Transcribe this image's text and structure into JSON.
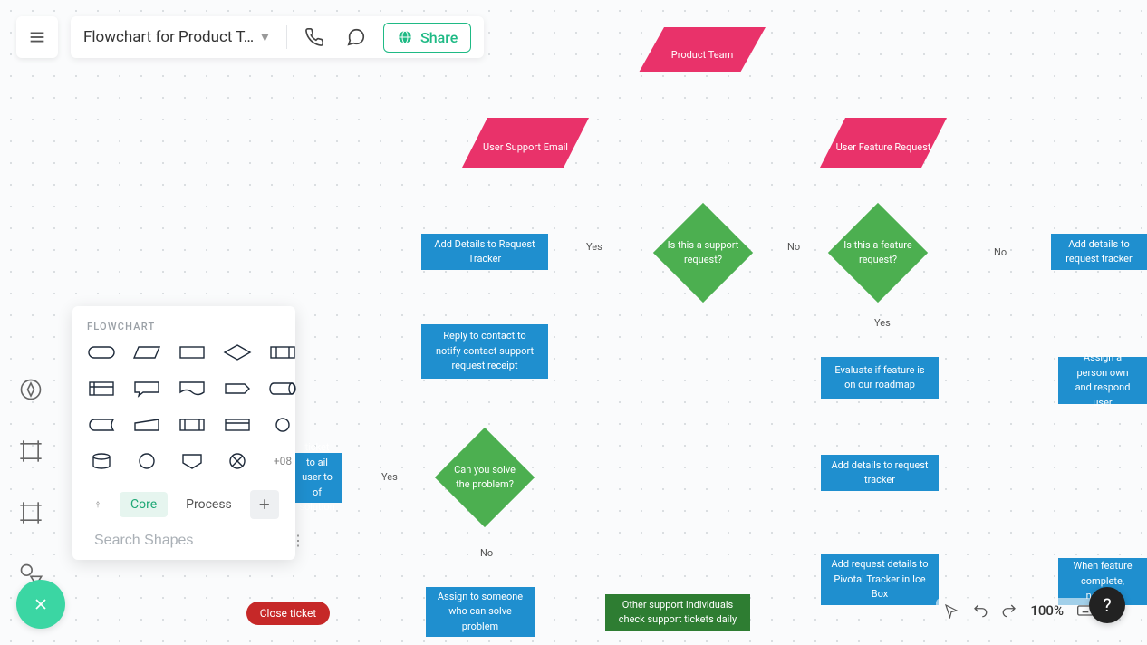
{
  "doc": {
    "title": "Flowchart for Product T…"
  },
  "toolbar": {
    "share_label": "Share"
  },
  "shape_panel": {
    "section_label": "FLOWCHART",
    "more_count": "+08",
    "tabs": {
      "core": "Core",
      "process": "Process"
    },
    "search_placeholder": "Search Shapes"
  },
  "bottom": {
    "zoom": "100%"
  },
  "flow": {
    "product_team": "Product Team",
    "user_support_email": "User Support Email",
    "user_feature_request": "User Feature Request",
    "is_support": "Is this a support request?",
    "is_feature": "Is this a feature request?",
    "add_details_tracker": "Add Details to Request Tracker",
    "add_details_tracker2": "Add details to request tracker",
    "reply_contact": "Reply to contact to notify contact support request receipt",
    "can_solve": "Can you solve the problem?",
    "assign_someone": "Assign to someone who can solve problem",
    "other_support": "Other support individuals check support tickets daily",
    "close_ticket": "Close ticket",
    "ticket_solution": "ticket to ail user to of solution",
    "evaluate_feature": "Evaluate if feature is on our roadmap",
    "add_details_tracker3": "Add details to request tracker",
    "pivotal_tracker": "Add request details to Pivotal Tracker in Ice Box",
    "assign_person": "Assign a person own and respond user",
    "when_complete": "When feature complete, notify it",
    "labels": {
      "yes": "Yes",
      "no": "No",
      "yes2": "Yes",
      "no2": "No",
      "yes3": "Yes",
      "no3": "No"
    }
  }
}
